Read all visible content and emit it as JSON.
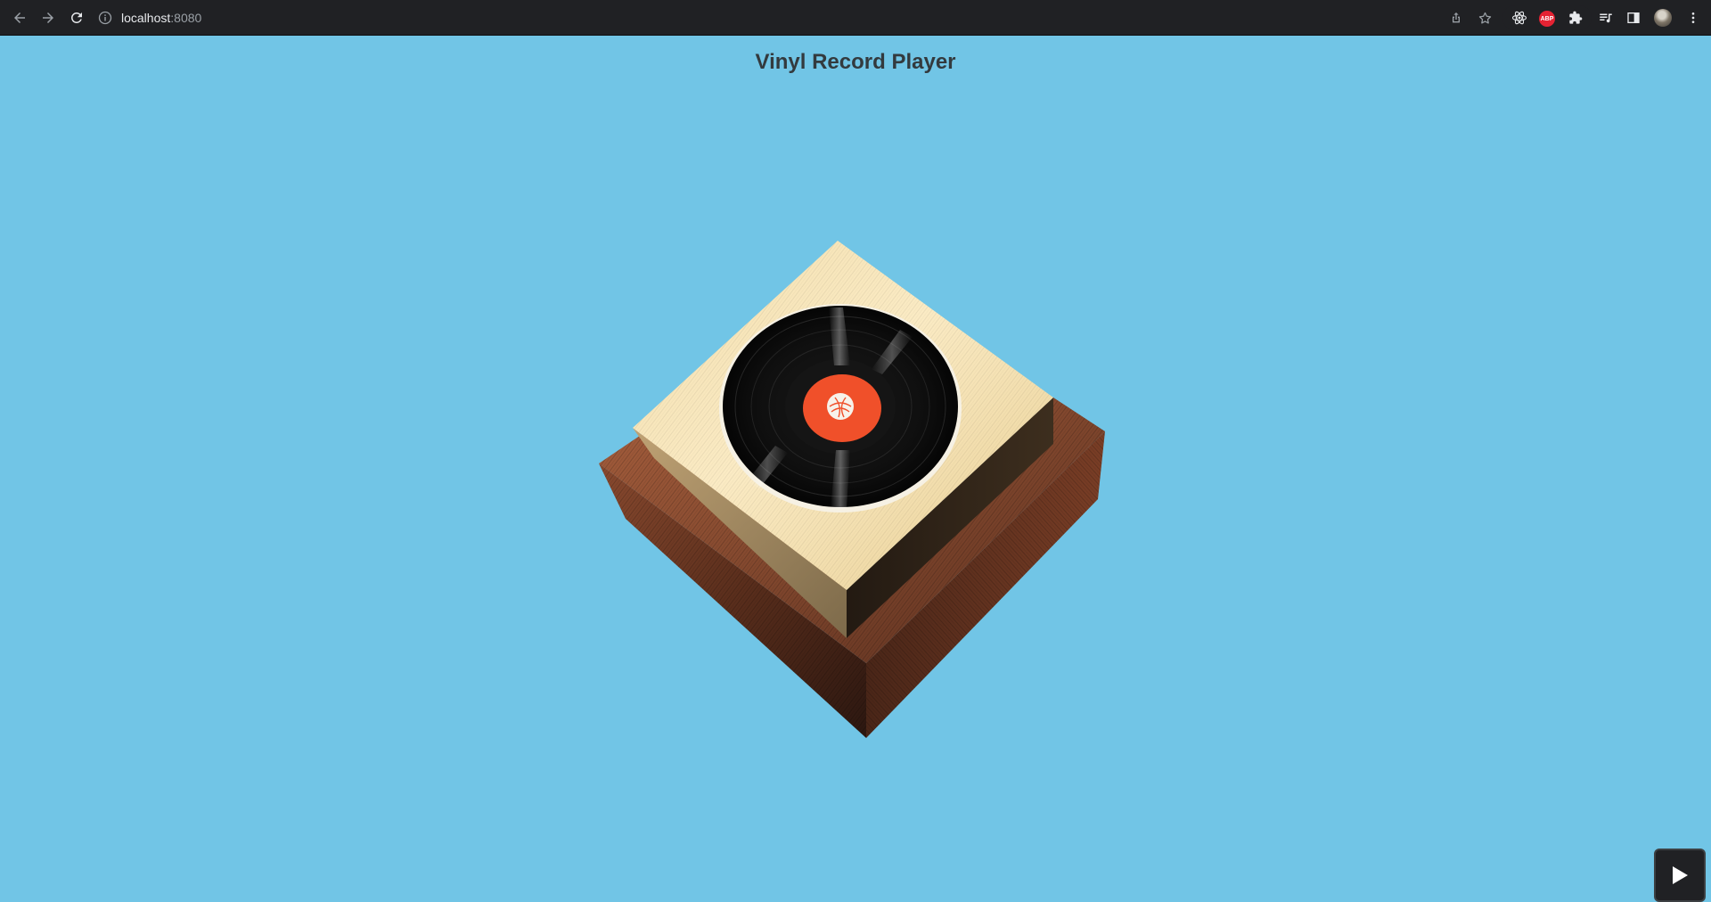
{
  "browser": {
    "url_host": "localhost",
    "url_port": ":8080",
    "extensions": {
      "abp_label": "ABP"
    }
  },
  "page": {
    "title": "Vinyl Record Player",
    "background_color": "#71c5e6"
  },
  "scene": {
    "base_material": "dark walnut wood",
    "top_material": "light maple wood",
    "record_label_color": "#f0502a",
    "record_color": "#0d0d0d"
  },
  "controls": {
    "play_icon": "play-icon"
  }
}
